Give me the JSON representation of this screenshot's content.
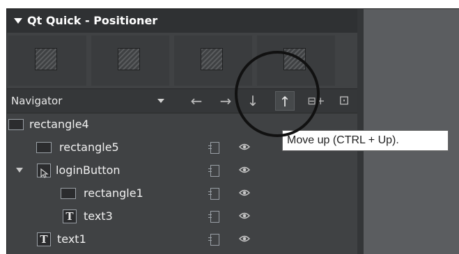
{
  "section": {
    "title": "Qt Quick - Positioner"
  },
  "palette": {
    "items": [
      {
        "icon": "positioner-icon"
      },
      {
        "icon": "positioner-icon"
      },
      {
        "icon": "positioner-icon"
      },
      {
        "icon": "positioner-icon"
      }
    ]
  },
  "navigator": {
    "label": "Navigator",
    "toolbar": [
      {
        "name": "move-left",
        "glyph": "←"
      },
      {
        "name": "move-right",
        "glyph": "→"
      },
      {
        "name": "move-down",
        "glyph": "↓"
      },
      {
        "name": "move-up",
        "glyph": "↑"
      },
      {
        "name": "add-child",
        "glyph": "⊟+"
      },
      {
        "name": "layout",
        "glyph": "⊡"
      }
    ]
  },
  "tree": {
    "items": [
      {
        "label": "rectangle4",
        "type": "rect",
        "level": 0,
        "expandable": false,
        "actions": false
      },
      {
        "label": "rectangle5",
        "type": "rect",
        "level": 1,
        "expandable": false,
        "actions": true
      },
      {
        "label": "loginButton",
        "type": "pointer",
        "level": 1,
        "expandable": true,
        "actions": true
      },
      {
        "label": "rectangle1",
        "type": "rect",
        "level": 2,
        "expandable": false,
        "actions": true
      },
      {
        "label": "text3",
        "type": "text",
        "level": 2,
        "expandable": false,
        "actions": true
      },
      {
        "label": "text1",
        "type": "text",
        "level": 1,
        "expandable": false,
        "actions": true
      }
    ],
    "text_icon_glyph": "T"
  },
  "tooltip": {
    "text": "Move up (CTRL + Up)."
  },
  "colors": {
    "panel": "#404244",
    "header": "#2f3133",
    "right_panel": "#5b5d60",
    "annotation_circle": "#111111"
  }
}
